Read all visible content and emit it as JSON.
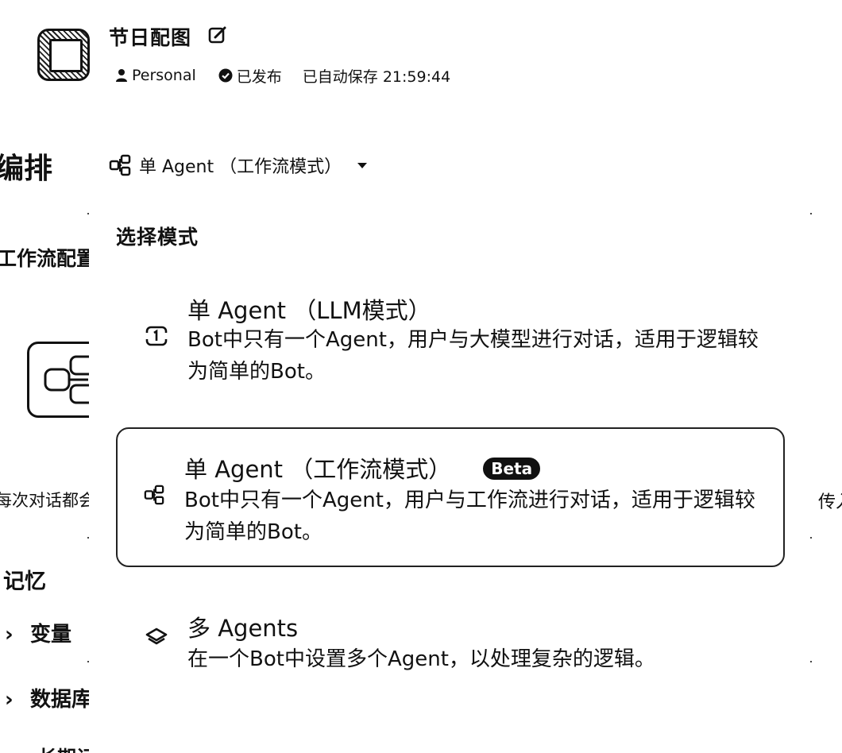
{
  "header": {
    "bot_name": "节日配图",
    "workspace": "Personal",
    "status": "已发布",
    "autosave": "已自动保存 21:59:44"
  },
  "left_panel": {
    "arrange": "编排",
    "workflow_config": "工作流配置",
    "each_turn": "每次对话都会",
    "memory": "记忆",
    "variables": "变量",
    "database": "数据库",
    "long_memory": "长期记忆"
  },
  "mode_selector": {
    "current": "单 Agent （工作流模式）",
    "heading": "选择模式",
    "options": [
      {
        "title": "单 Agent （LLM模式）",
        "description": "Bot中只有一个Agent，用户与大模型进行对话，适用于逻辑较为简单的Bot。",
        "icon": "single-agent-icon",
        "selected": false
      },
      {
        "title": "单 Agent （工作流模式）",
        "badge": "Beta",
        "description": "Bot中只有一个Agent，用户与工作流进行对话，适用于逻辑较为简单的Bot。",
        "icon": "workflow-icon",
        "selected": true
      },
      {
        "title": "多 Agents",
        "description": "在一个Bot中设置多个Agent，以处理复杂的逻辑。",
        "icon": "multi-agent-icon",
        "selected": false
      }
    ]
  },
  "right_clip": {
    "text": "传入"
  }
}
